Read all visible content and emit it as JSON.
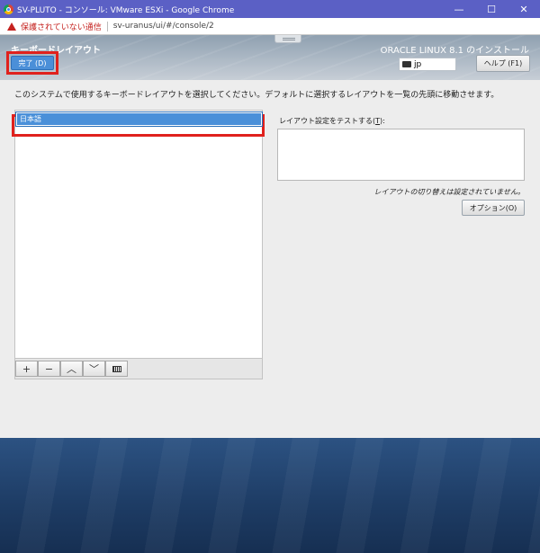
{
  "browser": {
    "window_title": "SV-PLUTO - コンソール: VMware ESXi - Google Chrome",
    "min_glyph": "—",
    "max_glyph": "☐",
    "close_glyph": "✕",
    "security_label": "保護されていない通信",
    "url": "sv-uranus/ui/#/console/2"
  },
  "installer": {
    "screen_title": "キーボードレイアウト",
    "done_label": "完了 (D)",
    "product_label": "ORACLE LINUX 8.1 のインストール",
    "keyboard_indicator": "jp",
    "help_label": "ヘルプ (F1)",
    "instruction": "このシステムで使用するキーボードレイアウトを選択してください。デフォルトに選択するレイアウトを一覧の先頭に移動させます。",
    "layouts": [
      "日本語"
    ],
    "toolbar": {
      "add": "+",
      "remove": "−",
      "up": "︿",
      "down": "﹀"
    },
    "test_label_prefix": "レイアウト設定をテストする(",
    "test_label_key": "T",
    "test_label_suffix": "):",
    "switch_note": "レイアウトの切り替えは設定されていません。",
    "options_label": "オプション(O)"
  },
  "colors": {
    "titlebar": "#5b60c5",
    "accent_blue": "#4a90d9",
    "highlight_red": "#e0211d",
    "footer": "#1e3d66"
  }
}
